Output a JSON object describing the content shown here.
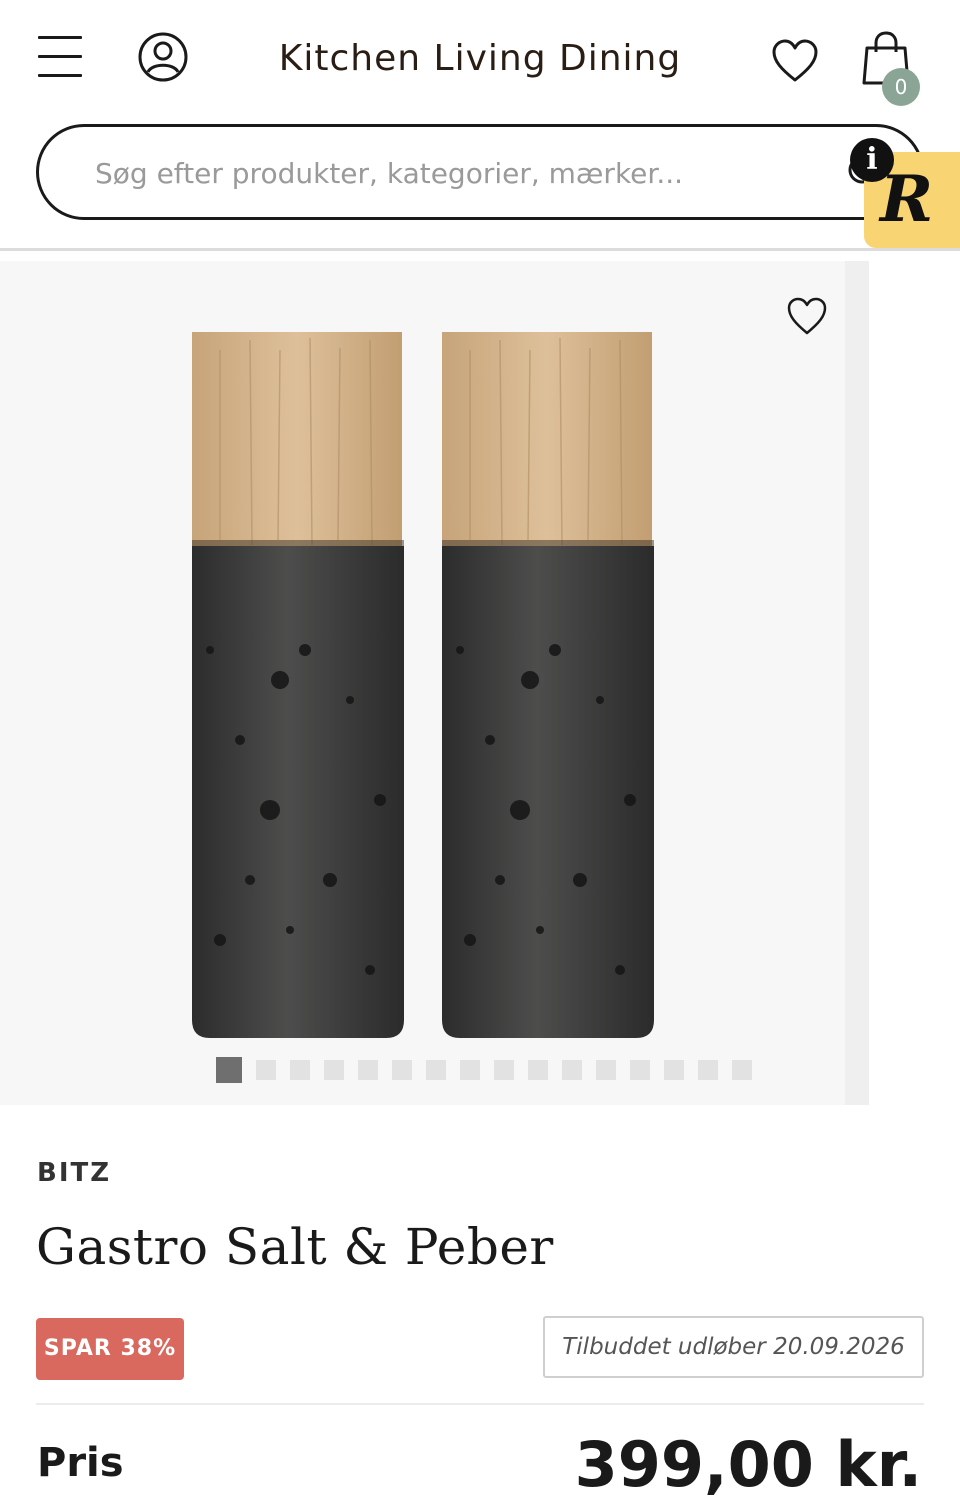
{
  "header": {
    "brand": "Kitchen Living Dining",
    "cart_count": "0",
    "icons": [
      "menu-icon",
      "user-icon",
      "heart-icon",
      "shopping-bag-icon"
    ]
  },
  "search": {
    "placeholder": "Søg efter produkter, kategorier, mærker...",
    "value": ""
  },
  "gallery": {
    "image_alt": "Gastro Salt & Peber",
    "slide_count": 16,
    "active_slide": 1
  },
  "product": {
    "brand": "BITZ",
    "title": "Gastro Salt & Peber",
    "save_label": "SPAR 38%",
    "offer_text": "Tilbuddet udløber 20.09.2026",
    "price_label": "Pris",
    "price": "399,00 kr."
  },
  "colors": {
    "save_badge": "#d9685f",
    "cart_badge": "#8aa595",
    "r_badge": "#f8d472"
  }
}
